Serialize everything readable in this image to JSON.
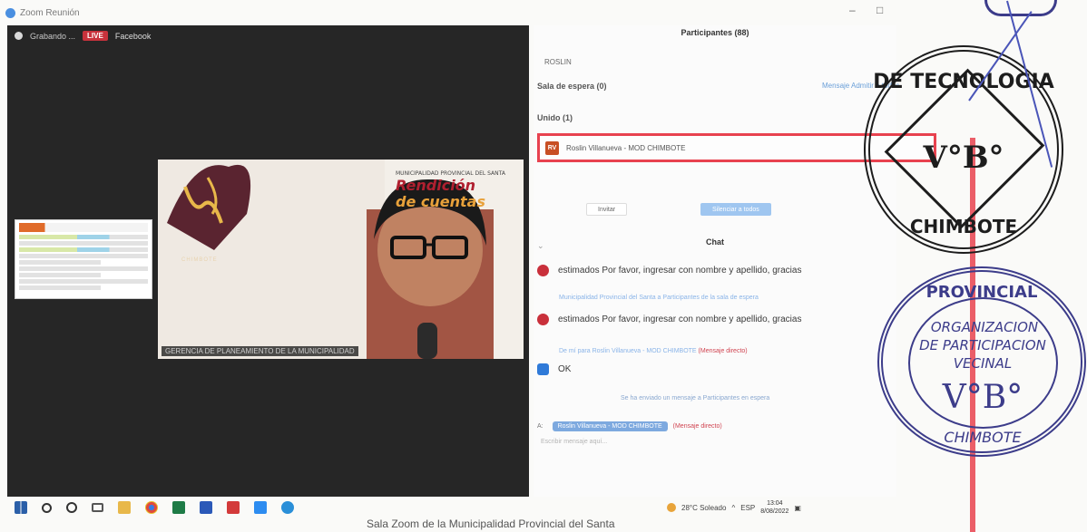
{
  "window": {
    "title": "Zoom Reunión",
    "controls": [
      "–",
      "□"
    ]
  },
  "recording": {
    "status": "Grabando ...",
    "live_badge": "LIVE",
    "platform": "Facebook"
  },
  "speaker": {
    "name_tag": "GERENCIA DE PLANEAMIENTO DE LA MUNICIPALIDAD",
    "banner_small": "MUNICIPALIDAD PROVINCIAL DEL SANTA",
    "banner_line1": "Rendición",
    "banner_line2": "de cuentas",
    "logo_text": "CHIMBOTE"
  },
  "participants": {
    "title": "Participantes (88)",
    "search_value": "ROSLIN",
    "waiting_room": "Sala de espera (0)",
    "waiting_actions": "Mensaje   Admitir a todos",
    "joined_header": "Unido (1)",
    "rows": [
      {
        "initials": "RV",
        "name": "Roslin Villanueva - MOD CHIMBOTE"
      }
    ],
    "invite_label": "Invitar",
    "mute_all_label": "Silenciar a todos"
  },
  "chat": {
    "title": "Chat",
    "messages": [
      {
        "text": "estimados Por favor, ingresar con nombre y apellido, gracias"
      },
      {
        "meta": "Municipalidad Provincial del Santa a Participantes de la sala de espera"
      },
      {
        "text": "estimados Por favor, ingresar con nombre y apellido, gracias"
      },
      {
        "meta": "De mí para Roslin Villanueva - MOD CHIMBOTE",
        "meta_tag": "(Mensaje directo)"
      },
      {
        "text": "OK"
      },
      {
        "meta": "Se ha enviado un mensaje a Participantes en espera"
      }
    ],
    "to_prefix": "A:",
    "to_recipient": "Roslin Villanueva - MOD CHIMBOTE",
    "to_tag": "(Mensaje directo)",
    "compose_placeholder": "Escribir mensaje aquí..."
  },
  "taskbar": {
    "weather": "28°C Soleado",
    "language": "ESP",
    "time": "13:04",
    "date": "8/08/2022",
    "app_icons": [
      "windows-start-icon",
      "search-icon",
      "cortana-icon",
      "task-view-icon",
      "file-explorer-icon",
      "chrome-icon",
      "excel-icon",
      "word-icon",
      "acrobat-icon",
      "zoom-icon",
      "edge-icon"
    ]
  },
  "caption": "Sala Zoom de la Municipalidad Provincial del Santa",
  "stamp_text": {
    "top": "MUNICIPALIDAD PROVINCIAL DEL SANTA - GERENCIA DE TECNOLOGIA",
    "top_center": "V°B°",
    "top_bottom": "CHIMBOTE",
    "bottom_arc": "MUNICIPALIDAD PROVINCIAL DEL SANTA",
    "bottom_center_1": "ORGANIZACION",
    "bottom_center_2": "DE PARTICIPACION",
    "bottom_center_3": "VECINAL",
    "bottom_vb": "V°B°",
    "bottom_bottom": "CHIMBOTE"
  },
  "colors": {
    "highlight_red": "#e8424f",
    "live_red": "#c8323c",
    "stamp_blue": "#3c3c8a",
    "video_bg": "#262626"
  }
}
